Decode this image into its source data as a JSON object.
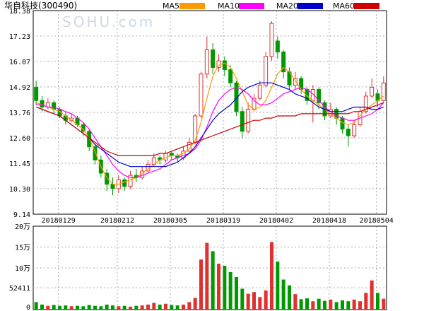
{
  "header": {
    "stock_name": "华自科技",
    "stock_code": "(300490)",
    "watermark": "SOHU.com"
  },
  "legend": [
    {
      "label": "MA5",
      "color": "#ff9900"
    },
    {
      "label": "MA10",
      "color": "#ff00ff"
    },
    {
      "label": "MA20",
      "color": "#0000cc"
    },
    {
      "label": "MA60",
      "color": "#cc0000"
    }
  ],
  "colors": {
    "up": "#e03030",
    "down": "#009900",
    "grid": "#aaaaaa",
    "axis": "#000000"
  },
  "chart_data": [
    {
      "type": "candlestick",
      "title": "华自科技(300490)",
      "y_ticks": [
        "18.38",
        "17.23",
        "16.07",
        "14.92",
        "13.76",
        "12.60",
        "11.45",
        "10.30",
        "9.14"
      ],
      "ylim": [
        9.14,
        18.38
      ],
      "x_ticks": [
        "20180129",
        "20180212",
        "20180305",
        "20180319",
        "20180402",
        "20180418",
        "20180504"
      ],
      "series": [
        {
          "name": "MA5",
          "values": [
            14.2,
            14.1,
            14.0,
            13.9,
            13.8,
            13.6,
            13.4,
            13.2,
            13.0,
            12.6,
            12.0,
            11.3,
            10.8,
            10.5,
            10.5,
            10.6,
            10.7,
            10.8,
            11.0,
            11.2,
            11.4,
            11.6,
            11.7,
            11.8,
            11.8,
            11.9,
            12.1,
            12.5,
            13.3,
            14.4,
            15.4,
            15.9,
            16.0,
            15.8,
            15.3,
            14.7,
            14.1,
            13.9,
            14.0,
            14.3,
            14.9,
            15.5,
            15.8,
            15.6,
            15.2,
            14.8,
            14.5,
            14.3,
            14.1,
            13.9,
            13.7,
            13.5,
            13.3,
            13.2,
            13.3,
            13.6,
            13.9,
            14.1,
            14.3,
            14.5
          ]
        },
        {
          "name": "MA10",
          "values": [
            14.1,
            14.1,
            14.0,
            14.0,
            13.9,
            13.8,
            13.7,
            13.5,
            13.3,
            13.0,
            12.6,
            12.2,
            11.8,
            11.4,
            11.1,
            10.9,
            10.8,
            10.8,
            10.9,
            11.0,
            11.1,
            11.2,
            11.4,
            11.6,
            11.7,
            11.8,
            11.9,
            12.1,
            12.5,
            13.1,
            13.8,
            14.3,
            14.6,
            14.8,
            14.9,
            14.8,
            14.6,
            14.3,
            14.1,
            14.1,
            14.2,
            14.4,
            14.6,
            14.7,
            14.8,
            14.9,
            14.8,
            14.6,
            14.3,
            14.0,
            13.8,
            13.6,
            13.5,
            13.4,
            13.4,
            13.5,
            13.6,
            13.7,
            13.9,
            14.2
          ]
        },
        {
          "name": "MA20",
          "values": [
            14.0,
            13.9,
            13.8,
            13.7,
            13.6,
            13.4,
            13.2,
            13.0,
            12.8,
            12.6,
            12.3,
            12.1,
            11.9,
            11.7,
            11.5,
            11.4,
            11.3,
            11.3,
            11.3,
            11.3,
            11.3,
            11.3,
            11.3,
            11.4,
            11.5,
            11.7,
            11.9,
            12.2,
            12.6,
            13.0,
            13.4,
            13.7,
            13.9,
            14.1,
            14.4,
            14.7,
            14.9,
            15.0,
            15.1,
            15.1,
            15.1,
            15.0,
            14.9,
            14.8,
            14.6,
            14.5,
            14.4,
            14.2,
            14.0,
            13.9,
            13.8,
            13.8,
            13.8,
            13.9,
            14.0,
            14.0,
            14.0,
            13.9,
            13.9,
            14.0
          ]
        },
        {
          "name": "MA60",
          "values": [
            14.0,
            13.9,
            13.8,
            13.7,
            13.6,
            13.4,
            13.2,
            13.0,
            12.8,
            12.6,
            12.4,
            12.2,
            12.0,
            11.9,
            11.8,
            11.8,
            11.8,
            11.8,
            11.8,
            11.8,
            11.8,
            11.9,
            11.9,
            12.0,
            12.1,
            12.2,
            12.3,
            12.4,
            12.5,
            12.6,
            12.7,
            12.8,
            12.9,
            13.0,
            13.1,
            13.2,
            13.3,
            13.4,
            13.4,
            13.5,
            13.5,
            13.6,
            13.6,
            13.6,
            13.6,
            13.7,
            13.7,
            13.7,
            13.7,
            13.7,
            13.7,
            13.7,
            13.7,
            13.7,
            13.8,
            13.8,
            13.9,
            14.0,
            14.1,
            14.2
          ]
        }
      ],
      "candles": [
        {
          "o": 14.9,
          "c": 14.3,
          "h": 15.2,
          "l": 14.1
        },
        {
          "o": 14.3,
          "c": 14.0,
          "h": 14.5,
          "l": 13.8
        },
        {
          "o": 14.0,
          "c": 14.2,
          "h": 14.4,
          "l": 13.9
        },
        {
          "o": 14.2,
          "c": 13.9,
          "h": 14.3,
          "l": 13.7
        },
        {
          "o": 13.9,
          "c": 13.6,
          "h": 14.0,
          "l": 13.5
        },
        {
          "o": 13.6,
          "c": 13.4,
          "h": 13.8,
          "l": 13.2
        },
        {
          "o": 13.4,
          "c": 13.5,
          "h": 13.7,
          "l": 13.3
        },
        {
          "o": 13.5,
          "c": 13.2,
          "h": 13.6,
          "l": 13.1
        },
        {
          "o": 13.2,
          "c": 12.9,
          "h": 13.3,
          "l": 12.7
        },
        {
          "o": 12.9,
          "c": 12.2,
          "h": 13.0,
          "l": 12.0
        },
        {
          "o": 12.2,
          "c": 11.6,
          "h": 12.3,
          "l": 11.4
        },
        {
          "o": 11.6,
          "c": 11.0,
          "h": 11.8,
          "l": 10.8
        },
        {
          "o": 11.0,
          "c": 10.5,
          "h": 11.2,
          "l": 10.2
        },
        {
          "o": 10.5,
          "c": 10.3,
          "h": 10.8,
          "l": 10.0
        },
        {
          "o": 10.3,
          "c": 10.7,
          "h": 10.9,
          "l": 10.1
        },
        {
          "o": 10.7,
          "c": 10.4,
          "h": 10.8,
          "l": 10.2
        },
        {
          "o": 10.4,
          "c": 10.9,
          "h": 11.1,
          "l": 10.3
        },
        {
          "o": 10.9,
          "c": 10.8,
          "h": 11.2,
          "l": 10.6
        },
        {
          "o": 10.8,
          "c": 11.1,
          "h": 11.3,
          "l": 10.7
        },
        {
          "o": 11.1,
          "c": 11.4,
          "h": 11.6,
          "l": 11.0
        },
        {
          "o": 11.4,
          "c": 11.7,
          "h": 11.9,
          "l": 11.3
        },
        {
          "o": 11.7,
          "c": 11.6,
          "h": 11.8,
          "l": 11.4
        },
        {
          "o": 11.6,
          "c": 11.9,
          "h": 12.0,
          "l": 11.5
        },
        {
          "o": 11.9,
          "c": 11.8,
          "h": 12.0,
          "l": 11.6
        },
        {
          "o": 11.8,
          "c": 11.7,
          "h": 11.9,
          "l": 11.5
        },
        {
          "o": 11.7,
          "c": 12.0,
          "h": 12.2,
          "l": 11.6
        },
        {
          "o": 12.0,
          "c": 12.4,
          "h": 12.6,
          "l": 11.9
        },
        {
          "o": 12.4,
          "c": 13.6,
          "h": 13.7,
          "l": 12.3
        },
        {
          "o": 13.6,
          "c": 15.5,
          "h": 15.6,
          "l": 13.5
        },
        {
          "o": 15.5,
          "c": 16.6,
          "h": 17.2,
          "l": 15.3
        },
        {
          "o": 16.6,
          "c": 15.8,
          "h": 16.9,
          "l": 15.5
        },
        {
          "o": 15.8,
          "c": 16.1,
          "h": 16.4,
          "l": 15.6
        },
        {
          "o": 16.1,
          "c": 15.7,
          "h": 16.3,
          "l": 15.4
        },
        {
          "o": 15.7,
          "c": 15.1,
          "h": 15.9,
          "l": 14.9
        },
        {
          "o": 15.1,
          "c": 13.8,
          "h": 15.2,
          "l": 13.6
        },
        {
          "o": 13.8,
          "c": 12.9,
          "h": 14.0,
          "l": 12.6
        },
        {
          "o": 12.9,
          "c": 13.9,
          "h": 14.2,
          "l": 12.8
        },
        {
          "o": 13.9,
          "c": 14.4,
          "h": 14.6,
          "l": 13.8
        },
        {
          "o": 14.4,
          "c": 15.0,
          "h": 15.2,
          "l": 14.3
        },
        {
          "o": 15.0,
          "c": 16.3,
          "h": 16.5,
          "l": 14.9
        },
        {
          "o": 16.3,
          "c": 17.8,
          "h": 17.9,
          "l": 16.1
        },
        {
          "o": 17.0,
          "c": 16.5,
          "h": 17.2,
          "l": 16.2
        },
        {
          "o": 16.5,
          "c": 15.6,
          "h": 16.6,
          "l": 15.3
        },
        {
          "o": 15.6,
          "c": 15.0,
          "h": 15.8,
          "l": 14.8
        },
        {
          "o": 15.0,
          "c": 15.3,
          "h": 15.6,
          "l": 14.8
        },
        {
          "o": 15.3,
          "c": 14.8,
          "h": 15.4,
          "l": 14.6
        },
        {
          "o": 14.8,
          "c": 14.3,
          "h": 14.9,
          "l": 14.1
        },
        {
          "o": 14.3,
          "c": 14.8,
          "h": 15.0,
          "l": 13.3
        },
        {
          "o": 14.8,
          "c": 14.2,
          "h": 14.9,
          "l": 13.9
        },
        {
          "o": 14.2,
          "c": 13.6,
          "h": 14.3,
          "l": 13.4
        },
        {
          "o": 13.6,
          "c": 13.9,
          "h": 14.2,
          "l": 13.5
        },
        {
          "o": 13.9,
          "c": 13.5,
          "h": 14.0,
          "l": 13.2
        },
        {
          "o": 13.5,
          "c": 13.0,
          "h": 13.6,
          "l": 12.8
        },
        {
          "o": 13.0,
          "c": 12.7,
          "h": 13.2,
          "l": 12.2
        },
        {
          "o": 12.7,
          "c": 13.2,
          "h": 13.4,
          "l": 12.6
        },
        {
          "o": 13.2,
          "c": 13.8,
          "h": 14.0,
          "l": 13.1
        },
        {
          "o": 13.8,
          "c": 14.5,
          "h": 14.7,
          "l": 13.7
        },
        {
          "o": 14.5,
          "c": 14.9,
          "h": 15.3,
          "l": 14.4
        },
        {
          "o": 14.6,
          "c": 14.3,
          "h": 14.8,
          "l": 14.0
        },
        {
          "o": 14.3,
          "c": 15.1,
          "h": 15.4,
          "l": 14.2
        }
      ]
    },
    {
      "type": "bar",
      "title": "",
      "y_ticks": [
        "20万",
        "15万",
        "10万",
        "52411",
        "0"
      ],
      "ylim": [
        0,
        200000
      ],
      "values": [
        18000,
        12000,
        9000,
        11000,
        9000,
        10000,
        8000,
        9000,
        8000,
        11000,
        9000,
        8000,
        12000,
        10000,
        8000,
        9000,
        7000,
        9000,
        10000,
        12000,
        16000,
        12000,
        14000,
        11000,
        10000,
        12000,
        18000,
        28000,
        120000,
        160000,
        140000,
        110000,
        105000,
        90000,
        78000,
        50000,
        38000,
        42000,
        30000,
        46000,
        162000,
        115000,
        72000,
        58000,
        37000,
        25000,
        27000,
        20000,
        26000,
        21000,
        24000,
        18000,
        22000,
        20000,
        24000,
        20000,
        40000,
        70000,
        40000,
        26000
      ]
    }
  ]
}
